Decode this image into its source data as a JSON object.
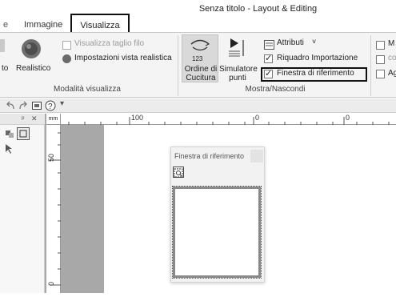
{
  "window": {
    "title": "Senza titolo - Layout & Editing"
  },
  "tabs": {
    "left_edge": "e",
    "image": "Immagine",
    "view": "Visualizza"
  },
  "ribbon": {
    "mode_group": {
      "label": "Modalità visualizza",
      "cut_label": "to",
      "realistic_label": "Realistico",
      "show_trim": "Visualizza taglio filo",
      "realistic_settings": "Impostazioni vista realistica"
    },
    "show_hide_group": {
      "label": "Mostra/Nascondi",
      "sewing_order": [
        "Ordine di",
        "Cucitura"
      ],
      "stitch_simulator": [
        "Simulatore",
        "punti"
      ],
      "sewing_order_number": "123",
      "attributes": "Attributi",
      "import_frame": "Riquadro Importazione",
      "reference_window": "Finestra di riferimento"
    },
    "right_group": {
      "item1": "M",
      "item2": "co",
      "item3": "Ag"
    }
  },
  "quick_access": {
    "items": [
      "undo",
      "redo",
      "screen",
      "help",
      "customize"
    ]
  },
  "left_panel": {
    "pin": "ᵖ",
    "close": "✕"
  },
  "ruler": {
    "unit": "mm",
    "top_labels": [
      "100",
      "0",
      "0"
    ],
    "left_labels": [
      "50",
      "0"
    ]
  },
  "reference_window": {
    "title": "Finestra di riferimento"
  }
}
